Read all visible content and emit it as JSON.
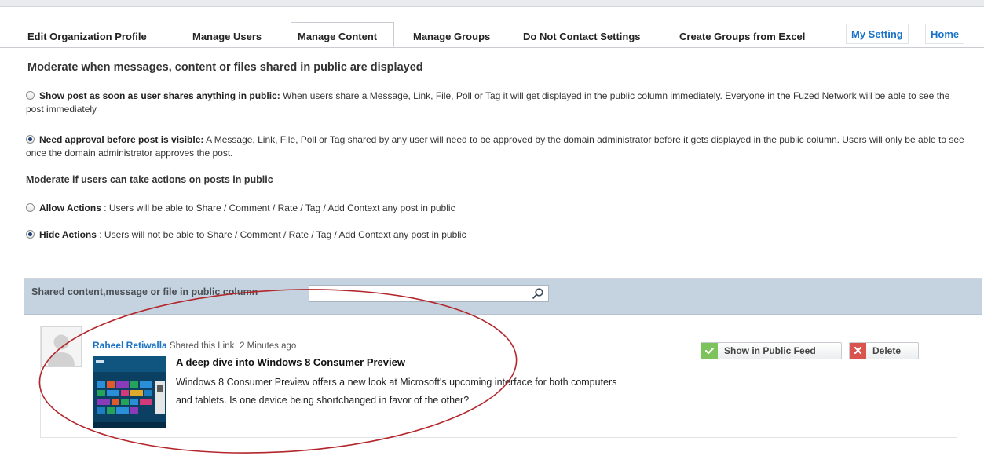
{
  "tabs": [
    {
      "label": "Edit Organization Profile"
    },
    {
      "label": "Manage Users"
    },
    {
      "label": "Manage Content"
    },
    {
      "label": "Manage Groups"
    },
    {
      "label": "Do Not Contact Settings"
    },
    {
      "label": "Create Groups from Excel"
    },
    {
      "label": "My Setting"
    },
    {
      "label": "Home"
    }
  ],
  "active_tab": "Manage Content",
  "moderation": {
    "heading": "Moderate when messages, content or files shared in public are displayed",
    "options": [
      {
        "title": "Show post as soon as user shares anything in public:",
        "text": " When users share a Message, Link, File, Poll or Tag it will get displayed in the public column immediately. Everyone in the Fuzed Network will be able to see the post immediately",
        "selected": false
      },
      {
        "title": "Need approval before post is visible:",
        "text": " A Message, Link, File, Poll or Tag shared by any user will need to be approved by the domain administrator before it gets displayed in the public column. Users will only be able to see once the domain administrator approves the post.",
        "selected": true
      }
    ]
  },
  "actions": {
    "heading": "Moderate if users can take actions on posts in public",
    "options": [
      {
        "title": "Allow Actions",
        "text": " : Users will be able to Share / Comment / Rate / Tag / Add Context any post in public",
        "selected": false
      },
      {
        "title": "Hide Actions",
        "text": " : Users will not be able to Share / Comment / Rate / Tag / Add Context any post in public",
        "selected": true
      }
    ]
  },
  "shared": {
    "title": "Shared content,message or file in public column",
    "search_value": "",
    "post": {
      "author": "Raheel Retiwalla",
      "action": " Shared this Link",
      "time": "2 Minutes ago",
      "title": "A deep dive into Windows 8 Consumer Preview",
      "description": "Windows 8 Consumer Preview offers a new look at Microsoft's upcoming interface for both computers and tablets. Is one device being shortchanged in favor of the other?"
    },
    "buttons": {
      "show": "Show in Public Feed",
      "delete": "Delete"
    }
  },
  "colors": {
    "accent_link": "#1a73c7",
    "panel_header": "#c5d3e0",
    "approve_green": "#7dc35b",
    "delete_red": "#d9534f",
    "annotation_ellipse": "#b3262b"
  }
}
